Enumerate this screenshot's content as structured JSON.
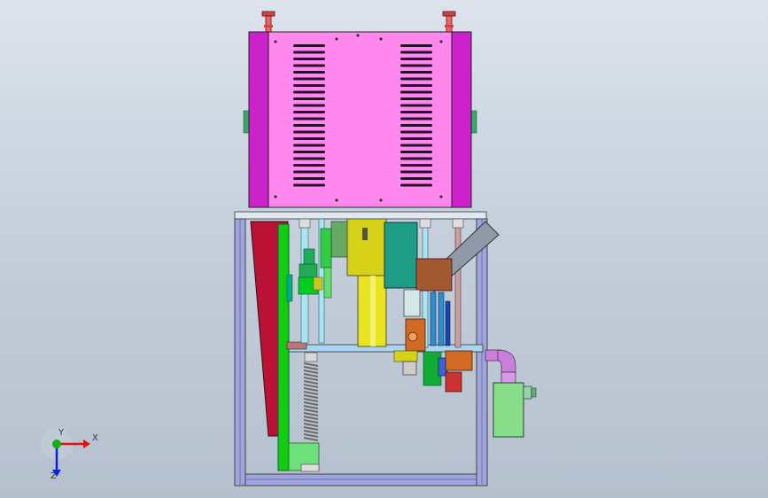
{
  "viewport": {
    "background_top": "#dce3ec",
    "background_bottom": "#b5c0ce"
  },
  "model": {
    "housing_color": "#ff88ee",
    "side_panel_color": "#cc22cc",
    "frame_color": "#9fa6dd",
    "rail_color": "#ba1235",
    "board_color": "#11cc11",
    "cylinder_color": "#d6d21a",
    "teal_block_color": "#1f9c86",
    "spring_color": "#777777",
    "elbow_color": "#c880dc",
    "tank_color": "#88dd88"
  },
  "triad": {
    "x_label": "X",
    "y_label": "Y",
    "z_label": "Z",
    "x_color": "#e01010",
    "y_color": "#10b010",
    "z_color": "#1020e0"
  }
}
